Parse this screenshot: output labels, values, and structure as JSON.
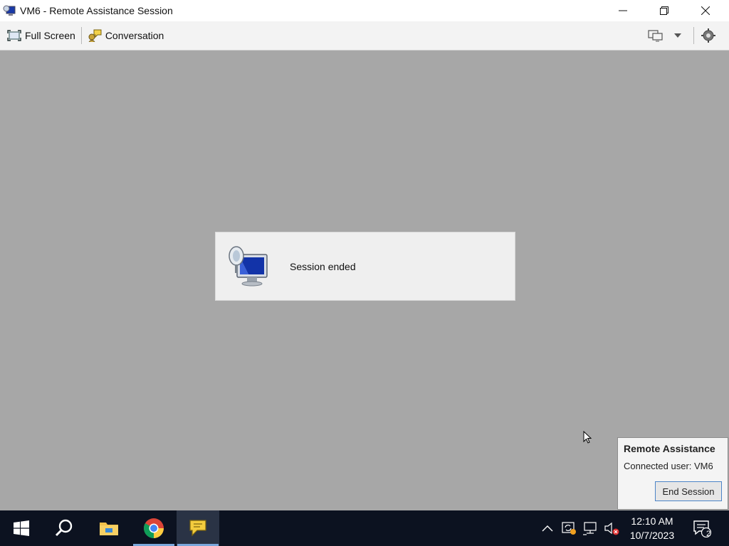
{
  "window": {
    "title": "VM6 - Remote Assistance Session",
    "icon": "remote-assistance-icon"
  },
  "window_controls": [
    "minimize-icon",
    "restore-icon",
    "close-icon"
  ],
  "toolbar": {
    "full_screen_label": "Full Screen",
    "conversation_label": "Conversation",
    "right_icons": [
      "display-icon",
      "chevron-down-icon",
      "settings-icon"
    ]
  },
  "session": {
    "message": "Session ended",
    "icon": "remote-monitor-icon"
  },
  "remote_assistance_panel": {
    "title": "Remote Assistance",
    "connected_user": "Connected user: VM6",
    "end_session_label": "End Session"
  },
  "taskbar": {
    "apps": [
      "start-icon",
      "search-icon",
      "file-explorer-icon",
      "chrome-icon",
      "remote-assistance-chat-icon"
    ],
    "tray_icons": [
      "chevron-up-icon",
      "sync-icon",
      "network-icon",
      "volume-muted-icon"
    ],
    "time": "12:10 AM",
    "date": "10/7/2023",
    "notification_count": "2",
    "colors": {
      "taskbar_bg": "#0c1220",
      "accent": "#7aa7db"
    }
  }
}
